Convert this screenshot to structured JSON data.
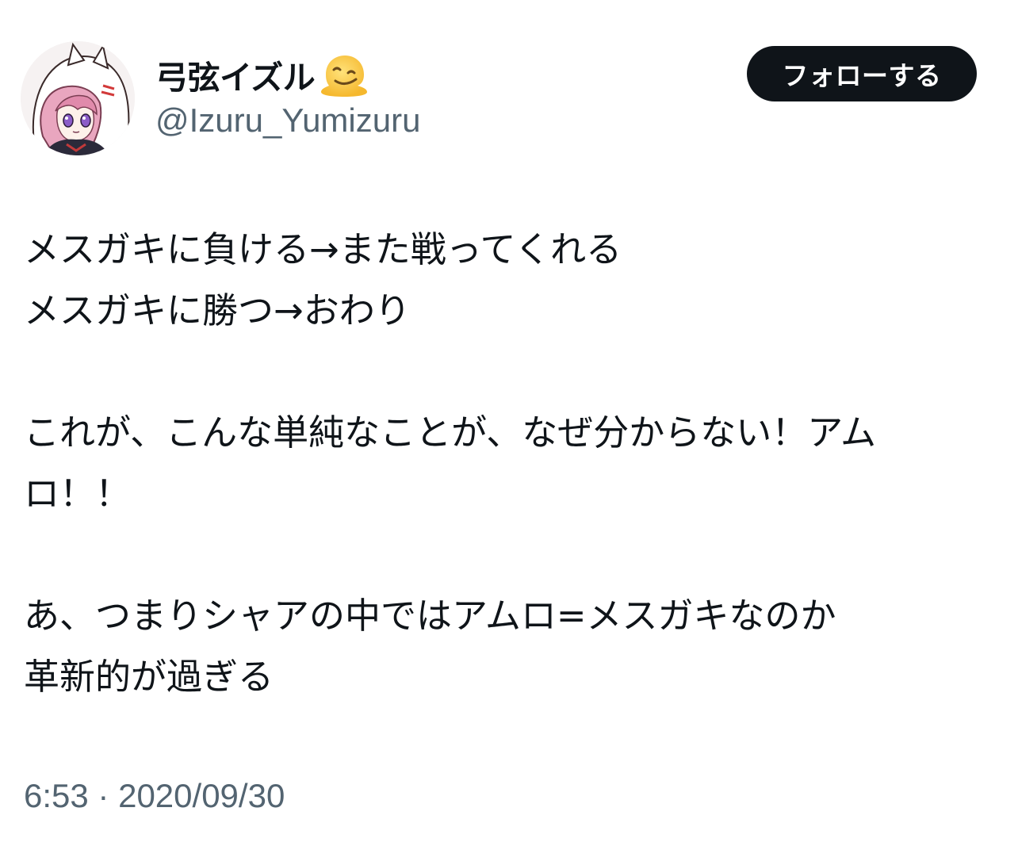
{
  "author": {
    "display_name": "弓弦イズル",
    "name_emoji": "melting-face-emoji",
    "handle": "@Izuru_Yumizuru",
    "avatar": "anime-character-avatar"
  },
  "follow_button": {
    "label": "フォローする"
  },
  "tweet": {
    "lines": [
      "メスガキに負ける→また戦ってくれる",
      "メスガキに勝つ→おわり",
      "",
      "これが、こんな単純なことが、なぜ分からない！アム",
      "ロ！！",
      "",
      "あ、つまりシャアの中ではアムロ=メスガキなのか",
      "革新的が過ぎる"
    ]
  },
  "meta": {
    "time": "6:53",
    "separator": "·",
    "date": "2020/09/30"
  },
  "colors": {
    "text": "#0f1419",
    "secondary": "#536471",
    "button_bg": "#0f1419",
    "button_text": "#ffffff"
  }
}
